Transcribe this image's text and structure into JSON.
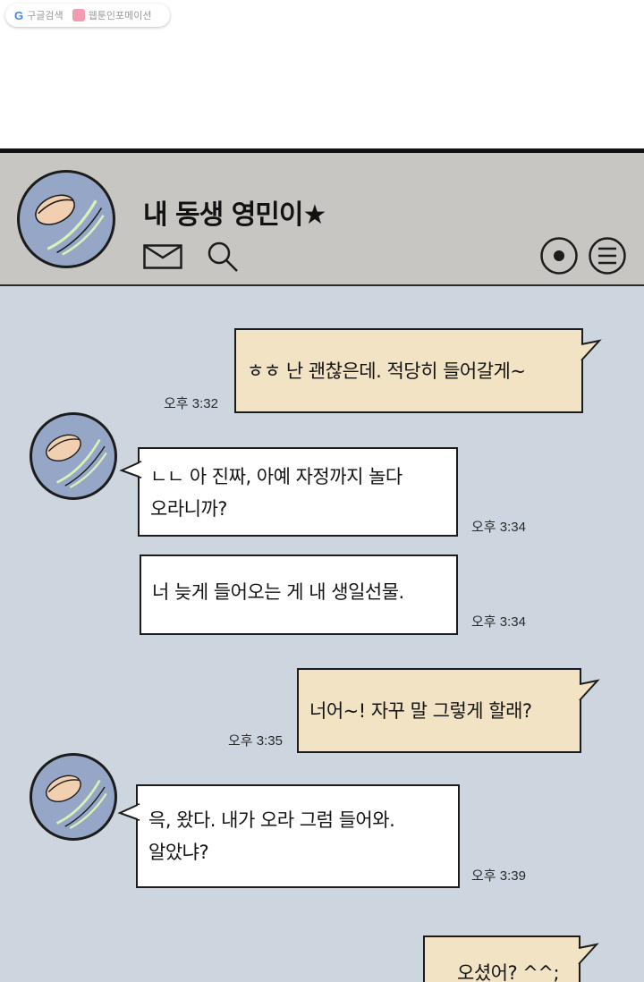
{
  "source_bar": {
    "search_label": "구글검색",
    "site_label": "웹툰인포메이션"
  },
  "header": {
    "contact_name": "내 동생 영민이★",
    "icons": [
      "mail-icon",
      "search-icon",
      "record-icon",
      "menu-icon"
    ]
  },
  "colors": {
    "header_bg": "#c7c6c2",
    "chat_bg": "#cdd6de",
    "my_bubble": "#f1e3c3",
    "their_bubble": "#ffffff",
    "avatar_bg": "#95a6c6"
  },
  "messages": [
    {
      "from": "me",
      "text": "ㅎㅎ 난 괜찮은데. 적당히 들어갈게~",
      "time": "오후 3:32"
    },
    {
      "from": "them",
      "text": "ㄴㄴ 아 진짜, 아예 자정까지 놀다\n오라니까?",
      "time": "오후 3:34"
    },
    {
      "from": "them",
      "text": "너 늦게 들어오는 게 내 생일선물.",
      "time": "오후 3:34"
    },
    {
      "from": "me",
      "text": "너어~! 자꾸 말 그렇게 할래?",
      "time": "오후 3:35"
    },
    {
      "from": "them",
      "text": "윽, 왔다. 내가 오라 그럼 들어와.\n알았냐?",
      "time": "오후 3:39"
    },
    {
      "from": "me",
      "text": "오셨어? ^^;",
      "time": ""
    }
  ]
}
